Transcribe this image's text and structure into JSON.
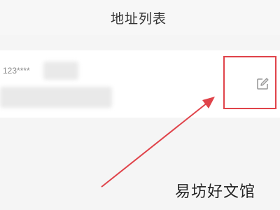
{
  "header": {
    "title": "地址列表"
  },
  "address_card": {
    "phone": "123****",
    "edit_icon": "edit-icon"
  },
  "annotation": {
    "highlight_color": "#e0434a",
    "arrow_color": "#e0434a"
  },
  "watermark": {
    "text": "易坊好文馆"
  }
}
